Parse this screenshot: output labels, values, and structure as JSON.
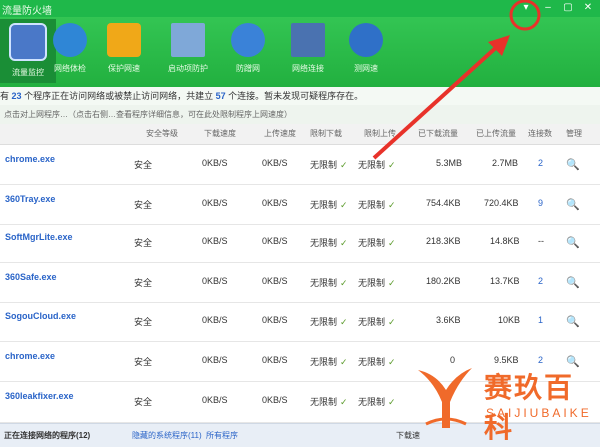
{
  "title_bar": {
    "title": "流量防火墙",
    "buttons": [
      "▾",
      "–",
      "▢",
      "✕"
    ]
  },
  "toolbar": {
    "items": [
      {
        "label": "流量监控",
        "color": "#4a78c8",
        "active": true
      },
      {
        "label": "网络体检",
        "color": "#2f86d6",
        "active": false
      },
      {
        "label": "保护网速",
        "color": "#f0a818",
        "active": false
      },
      {
        "label": "启动项防护",
        "color": "#7fa8d8",
        "active": false
      },
      {
        "label": "防蹭网",
        "color": "#3a82d8",
        "active": false
      },
      {
        "label": "网络连接",
        "color": "#4a72b0",
        "active": false
      },
      {
        "label": "测网速",
        "color": "#2f70c8",
        "active": false
      }
    ]
  },
  "info": {
    "prefix": "有",
    "process_count": "23",
    "middle": "个程序正在访问网络或被禁止访问网络，共建立",
    "conn_count": "57",
    "suffix": "个连接。暂未发现可疑程序存在。"
  },
  "hint": "点击对上网程序…（点击右侧…查看程序详细信息，可在此处限制程序上网速度）",
  "columns": [
    "安全等级",
    "下载速度",
    "上传速度",
    "限制下载",
    "限制上传",
    "已下载流量",
    "已上传流量",
    "连接数",
    "管理"
  ],
  "rows": [
    {
      "name": "chrome.exe",
      "level": "安全",
      "down": "0KB/S",
      "up": "0KB/S",
      "lim_down": "无限制",
      "lim_up": "无限制",
      "downloaded": "5.3MB",
      "uploaded": "2.7MB",
      "conns": "2",
      "manage": "🔍"
    },
    {
      "name": "360Tray.exe",
      "level": "安全",
      "down": "0KB/S",
      "up": "0KB/S",
      "lim_down": "无限制",
      "lim_up": "无限制",
      "downloaded": "754.4KB",
      "uploaded": "720.4KB",
      "conns": "9",
      "manage": "🔍"
    },
    {
      "name": "SoftMgrLite.exe",
      "level": "安全",
      "down": "0KB/S",
      "up": "0KB/S",
      "lim_down": "无限制",
      "lim_up": "无限制",
      "downloaded": "218.3KB",
      "uploaded": "14.8KB",
      "conns": "--",
      "manage": "🔍"
    },
    {
      "name": "360Safe.exe",
      "level": "安全",
      "down": "0KB/S",
      "up": "0KB/S",
      "lim_down": "无限制",
      "lim_up": "无限制",
      "downloaded": "180.2KB",
      "uploaded": "13.7KB",
      "conns": "2",
      "manage": "🔍"
    },
    {
      "name": "SogouCloud.exe",
      "level": "安全",
      "down": "0KB/S",
      "up": "0KB/S",
      "lim_down": "无限制",
      "lim_up": "无限制",
      "downloaded": "3.6KB",
      "uploaded": "10KB",
      "conns": "1",
      "manage": "🔍"
    },
    {
      "name": "chrome.exe",
      "level": "安全",
      "down": "0KB/S",
      "up": "0KB/S",
      "lim_down": "无限制",
      "lim_up": "无限制",
      "downloaded": "0",
      "uploaded": "9.5KB",
      "conns": "2",
      "manage": "🔍"
    },
    {
      "name": "360leakfixer.exe",
      "level": "安全",
      "down": "0KB/S",
      "up": "0KB/S",
      "lim_down": "无限制",
      "lim_up": "无限制",
      "downloaded": "",
      "uploaded": "",
      "conns": "",
      "manage": ""
    }
  ],
  "bottom": {
    "tab1": "正在连接网络的程序(12)",
    "tab2": "隐藏的系统程序(11)",
    "tab3": "所有程序",
    "right_text": "下载速"
  },
  "watermark": {
    "cn": "赛玖百科",
    "en": "SAIJIUBAIKE"
  },
  "colors": {
    "green": "#22b03f",
    "link_blue": "#2a64c8",
    "annotation_red": "#e8322a",
    "watermark_orange": "#f06a2a"
  }
}
